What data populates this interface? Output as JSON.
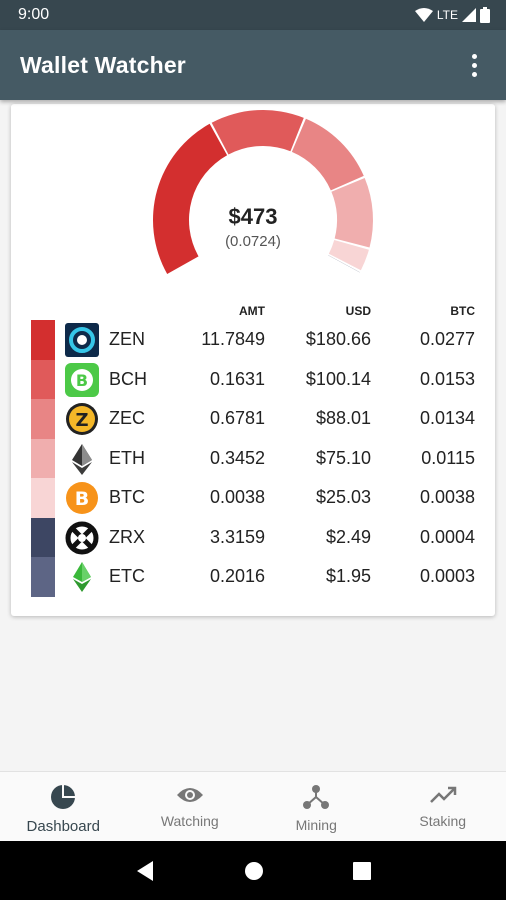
{
  "status": {
    "time": "9:00",
    "network": "LTE"
  },
  "app": {
    "title": "Wallet Watcher"
  },
  "summary": {
    "total_usd": "$473",
    "total_btc": "(0.0724)"
  },
  "table": {
    "headers": {
      "amt": "AMT",
      "usd": "USD",
      "btc": "BTC"
    },
    "rows": [
      {
        "symbol": "ZEN",
        "amt": "11.7849",
        "usd": "$180.66",
        "btc": "0.0277",
        "color": "#d32f2f",
        "icon": "zen-icon"
      },
      {
        "symbol": "BCH",
        "amt": "0.1631",
        "usd": "$100.14",
        "btc": "0.0153",
        "color": "#e05a5a",
        "icon": "bch-icon"
      },
      {
        "symbol": "ZEC",
        "amt": "0.6781",
        "usd": "$88.01",
        "btc": "0.0134",
        "color": "#e88585",
        "icon": "zec-icon"
      },
      {
        "symbol": "ETH",
        "amt": "0.3452",
        "usd": "$75.10",
        "btc": "0.0115",
        "color": "#f0aeae",
        "icon": "eth-icon"
      },
      {
        "symbol": "BTC",
        "amt": "0.0038",
        "usd": "$25.03",
        "btc": "0.0038",
        "color": "#f8d5d5",
        "icon": "btc-icon"
      },
      {
        "symbol": "ZRX",
        "amt": "3.3159",
        "usd": "$2.49",
        "btc": "0.0004",
        "color": "#3d4663",
        "icon": "zrx-icon"
      },
      {
        "symbol": "ETC",
        "amt": "0.2016",
        "usd": "$1.95",
        "btc": "0.0003",
        "color": "#5d6585",
        "icon": "etc-icon"
      }
    ]
  },
  "nav": {
    "items": [
      {
        "label": "Dashboard",
        "icon": "pie-chart-icon",
        "active": true
      },
      {
        "label": "Watching",
        "icon": "eye-icon",
        "active": false
      },
      {
        "label": "Mining",
        "icon": "network-icon",
        "active": false
      },
      {
        "label": "Staking",
        "icon": "trending-up-icon",
        "active": false
      }
    ]
  }
}
